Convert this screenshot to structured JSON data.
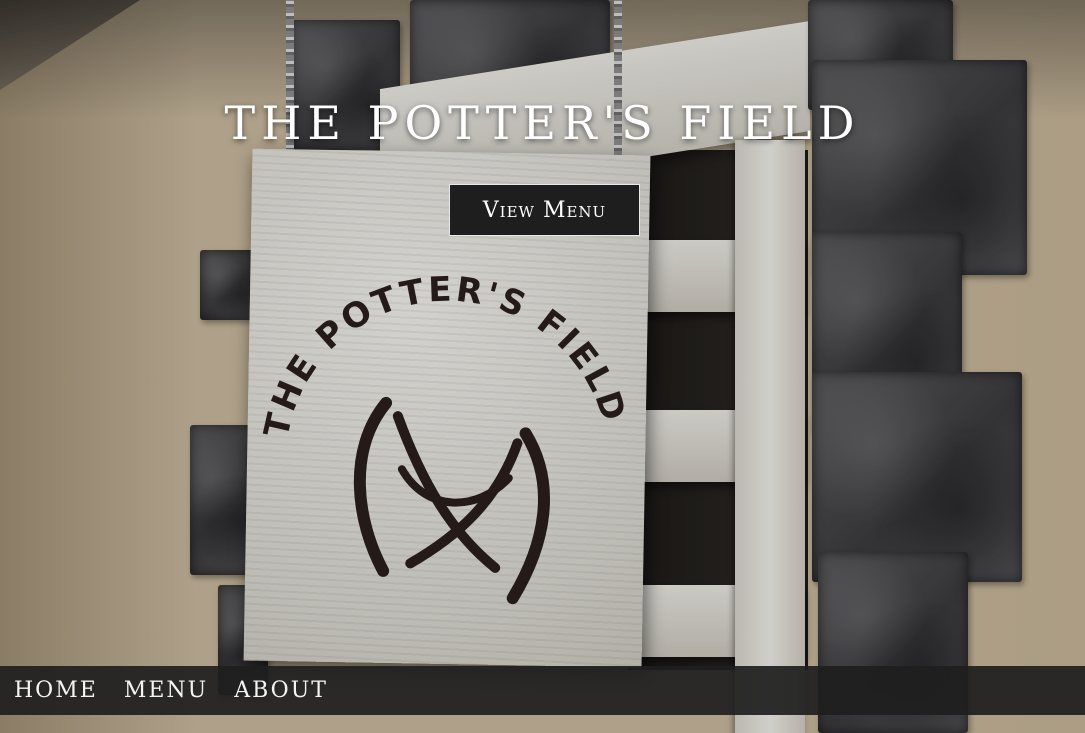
{
  "hero": {
    "title": "THE POTTER'S FIELD",
    "cta_label": "View Menu"
  },
  "sign": {
    "logo_text": "THE POTTER'S FIELD"
  },
  "nav": {
    "items": [
      {
        "label": "HOME"
      },
      {
        "label": "MENU"
      },
      {
        "label": "ABOUT"
      }
    ]
  },
  "colors": {
    "nav_background": "#1e1e1e",
    "button_background": "#1e1e1e",
    "text": "#ffffff"
  }
}
